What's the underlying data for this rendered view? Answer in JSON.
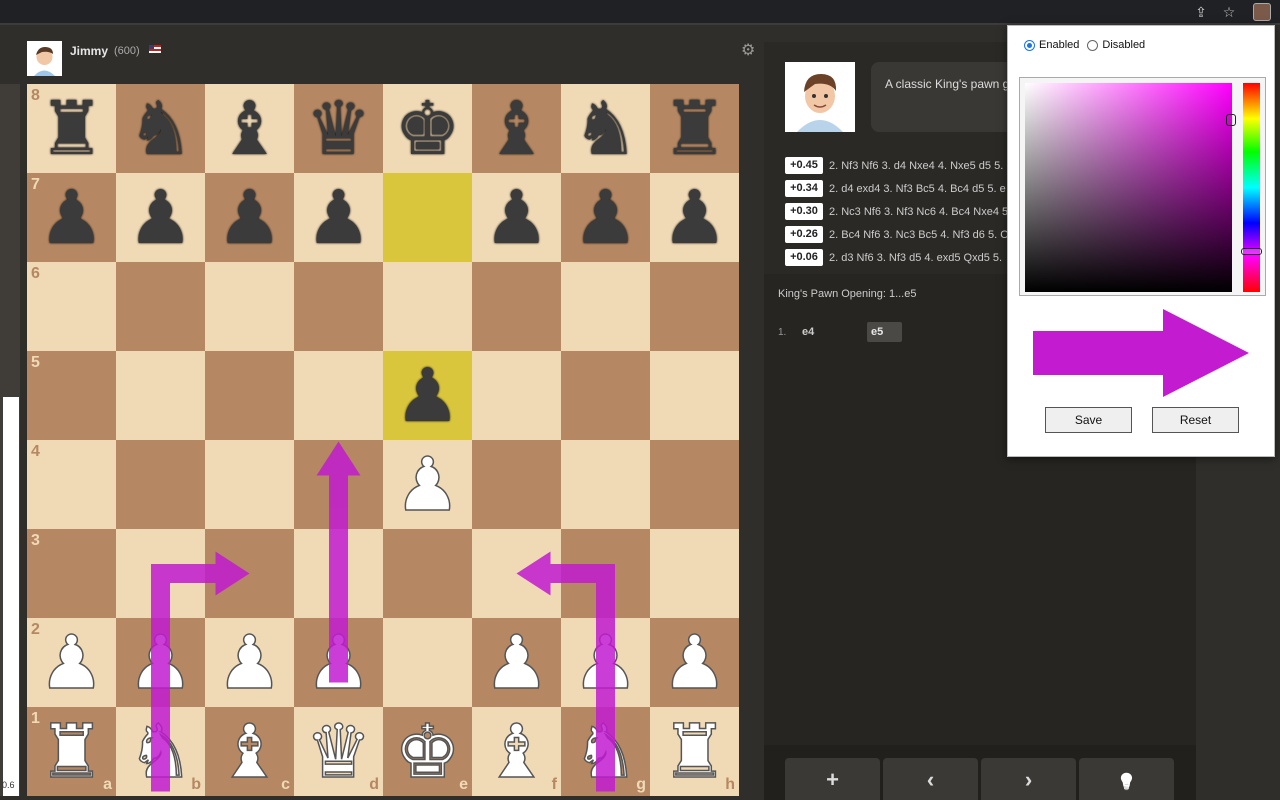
{
  "player": {
    "name": "Jimmy",
    "rating": "(600)",
    "flag": "us-flag"
  },
  "eval": {
    "value": 0.6,
    "label": "0.6",
    "white_fraction": 0.56
  },
  "board": {
    "ranks": [
      "8",
      "7",
      "6",
      "5",
      "4",
      "3",
      "2",
      "1"
    ],
    "files": [
      "a",
      "b",
      "c",
      "d",
      "e",
      "f",
      "g",
      "h"
    ],
    "position": [
      [
        "r",
        "n",
        "b",
        "q",
        "k",
        "b",
        "n",
        "r"
      ],
      [
        "p",
        "p",
        "p",
        "p",
        "",
        "p",
        "p",
        "p"
      ],
      [
        "",
        "",
        "",
        "",
        "",
        "",
        "",
        ""
      ],
      [
        "",
        "",
        "",
        "",
        "p",
        "",
        "",
        ""
      ],
      [
        "",
        "",
        "",
        "",
        "P",
        "",
        "",
        ""
      ],
      [
        "",
        "",
        "",
        "",
        "",
        "",
        "",
        ""
      ],
      [
        "P",
        "P",
        "P",
        "P",
        "",
        "P",
        "P",
        "P"
      ],
      [
        "R",
        "N",
        "B",
        "Q",
        "K",
        "B",
        "N",
        "R"
      ]
    ],
    "highlight_squares": [
      "e7",
      "e5"
    ],
    "arrow_color": "#c21bd0",
    "arrows": [
      {
        "from": "b1",
        "to": "c3",
        "type": "knight"
      },
      {
        "from": "d2",
        "to": "d4",
        "type": "straight"
      },
      {
        "from": "g1",
        "to": "f3",
        "type": "knight"
      }
    ],
    "light_color": "#f0d9b5",
    "dark_color": "#b58863",
    "highlight_color": "#d9c63c"
  },
  "coach": {
    "message": "A classic King's pawn g"
  },
  "lines": [
    {
      "eval": "+0.45",
      "moves": "2. Nf3 Nf6 3. d4 Nxe4 4. Nxe5 d5 5."
    },
    {
      "eval": "+0.34",
      "moves": "2. d4 exd4 3. Nf3 Bc5 4. Bc4 d5 5. e"
    },
    {
      "eval": "+0.30",
      "moves": "2. Nc3 Nf6 3. Nf3 Nc6 4. Bc4 Nxe4 5"
    },
    {
      "eval": "+0.26",
      "moves": "2. Bc4 Nf6 3. Nc3 Bc5 4. Nf3 d6 5. O"
    },
    {
      "eval": "+0.06",
      "moves": "2. d3 Nf6 3. Nf3 d5 4. exd5 Qxd5 5."
    }
  ],
  "opening": "King's Pawn Opening: 1...e5",
  "moves": [
    {
      "num": "1.",
      "white": "e4",
      "black": "e5"
    }
  ],
  "nav": [
    {
      "name": "add-button",
      "icon": "plus-icon",
      "glyph": "+"
    },
    {
      "name": "previous-button",
      "icon": "chevron-left-icon",
      "glyph": "‹"
    },
    {
      "name": "next-button",
      "icon": "chevron-right-icon",
      "glyph": "›"
    },
    {
      "name": "hint-button",
      "icon": "lightbulb-icon",
      "glyph": "💡"
    }
  ],
  "popup": {
    "enabled_label": "Enabled",
    "disabled_label": "Disabled",
    "enabled": true,
    "picker_hue_color": "#ff00ff",
    "selected_color": "#c21bd0",
    "save_label": "Save",
    "reset_label": "Reset"
  }
}
